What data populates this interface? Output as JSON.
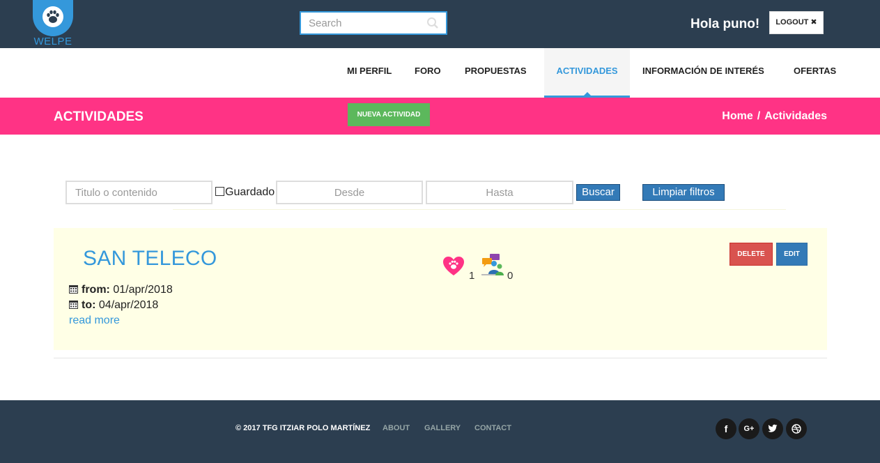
{
  "brand": {
    "name": "WELPE"
  },
  "header": {
    "search_placeholder": "Search",
    "greeting": "Hola puno!",
    "logout_label": "LOGOUT ✖"
  },
  "nav": {
    "items": [
      {
        "label": "MI PERFIL"
      },
      {
        "label": "FORO"
      },
      {
        "label": "PROPUESTAS"
      },
      {
        "label": "ACTIVIDADES"
      },
      {
        "label": "INFORMACIÓN DE INTERÉS"
      },
      {
        "label": "OFERTAS"
      }
    ],
    "active": "ACTIVIDADES"
  },
  "section": {
    "title": "ACTIVIDADES",
    "new_button": "NUEVA ACTIVIDAD",
    "breadcrumb": {
      "home": "Home",
      "separator": "/",
      "current": "Actividades"
    }
  },
  "filters": {
    "title_placeholder": "Titulo o contenido",
    "saved_label": "Guardado",
    "from_placeholder": "Desde",
    "to_placeholder": "Hasta",
    "search_button": "Buscar",
    "clear_button": "Limpiar filtros"
  },
  "activity": {
    "title": "SAN TELECO",
    "from_label": "from:",
    "from_value": "01/apr/2018",
    "to_label": "to:",
    "to_value": "04/apr/2018",
    "read_more": "read more",
    "likes": "1",
    "participants": "0",
    "delete_label": "DELETE",
    "edit_label": "EDIT"
  },
  "footer": {
    "copyright": "© 2017 TFG ITZIAR POLO MARTÍNEZ",
    "links": [
      {
        "label": "ABOUT"
      },
      {
        "label": "GALLERY"
      },
      {
        "label": "CONTACT"
      }
    ],
    "social": [
      {
        "icon": "facebook-icon",
        "glyph": "f"
      },
      {
        "icon": "google-plus-icon",
        "glyph": "G+"
      },
      {
        "icon": "twitter-icon"
      },
      {
        "icon": "dribbble-icon"
      }
    ]
  },
  "colors": {
    "topbar": "#2c3e50",
    "accent": "#3498db",
    "pink": "#ff3385",
    "success": "#5cb85c",
    "danger": "#d9534f",
    "card_bg": "#ffffe6"
  }
}
